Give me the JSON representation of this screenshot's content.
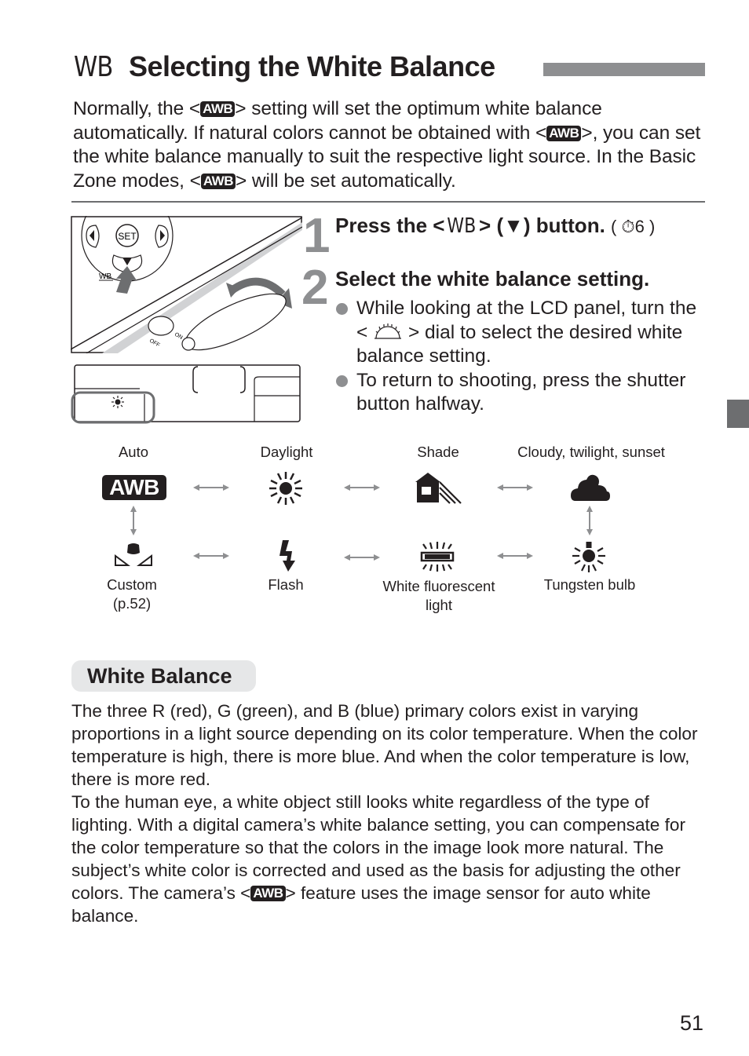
{
  "title": {
    "icon": "wb-icon",
    "icon_text": "WB",
    "text": "Selecting the White Balance"
  },
  "intro": {
    "line1_a": "Normally, the <",
    "awb": "AWB",
    "line1_b": "> setting will set the optimum white balance automatically. If natural colors cannot be obtained with <",
    "line1_c": ">, you can set the white balance manually to suit the respective light source. In the Basic Zone modes, <",
    "line1_d": "> will be set automatically."
  },
  "illustration": {
    "button_labels": {
      "set": "SET",
      "wb": "WB",
      "on": "ON",
      "off": "OFF"
    }
  },
  "steps": [
    {
      "number": "1",
      "heading_a": "Press the <",
      "heading_icon": "WB",
      "heading_b": "> (",
      "heading_arrow": "▼",
      "heading_c": ") button.",
      "ref": "( ⏱6 )"
    },
    {
      "number": "2",
      "heading": "Select the white balance setting.",
      "bullets": [
        {
          "a": "While looking at the LCD panel, turn the <",
          "icon": "main-dial-icon",
          "b": "> dial to select the desired white balance setting."
        },
        {
          "a": "To return to shooting, press the shutter button halfway."
        }
      ]
    }
  ],
  "wb_modes": [
    {
      "label": "Auto",
      "icon": "awb-icon",
      "icon_text": "AWB"
    },
    {
      "label": "Daylight",
      "icon": "daylight-sun-icon"
    },
    {
      "label": "Shade",
      "icon": "shade-house-icon"
    },
    {
      "label": "Cloudy, twilight, sunset",
      "icon": "cloudy-icon"
    },
    {
      "label": "Tungsten bulb",
      "icon": "tungsten-bulb-icon"
    },
    {
      "label": "White fluorescent light",
      "label_line1": "White fluorescent",
      "label_line2": "light",
      "icon": "fluorescent-icon"
    },
    {
      "label": "Flash",
      "icon": "flash-icon"
    },
    {
      "label": "Custom (p.52)",
      "label_line1": "Custom",
      "label_line2": "(p.52)",
      "icon": "custom-wb-icon"
    }
  ],
  "white_balance_section": {
    "heading": "White Balance",
    "para1": "The three R (red), G (green), and B (blue) primary colors exist in varying proportions in a light source depending on its color temperature. When the color temperature is high, there is more blue. And when the color temperature is low, there is more red.",
    "para2_a": "To the human eye, a white object still looks white regardless of the type of lighting. With a digital camera’s white balance setting, you can compensate for the color temperature so that the colors in the image look more natural. The subject’s white color is corrected and used as the basis for adjusting the other colors. The camera’s <",
    "para2_awb": "AWB",
    "para2_b": "> feature uses the image sensor for auto white balance."
  },
  "page_number": "51",
  "colors": {
    "text": "#231f20",
    "gray_accent": "#8e8f91",
    "side_tab": "#6d6e70",
    "box_bg": "#e6e7e8"
  }
}
